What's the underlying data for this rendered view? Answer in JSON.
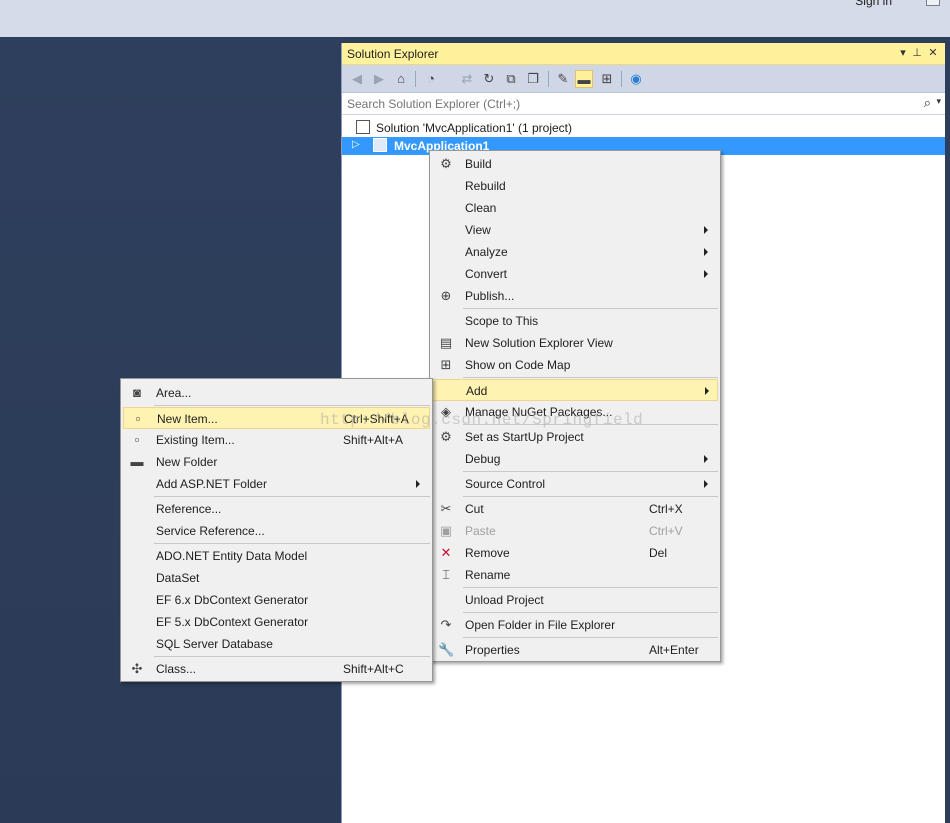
{
  "window": {
    "sign_in": "Sign in"
  },
  "solution_explorer": {
    "title": "Solution Explorer",
    "header_buttons": {
      "dropdown": "▾",
      "pin": "⊥",
      "close": "✕"
    },
    "search_placeholder": "Search Solution Explorer (Ctrl+;)",
    "tree": {
      "solution_label": "Solution 'MvcApplication1' (1 project)",
      "project_label": "MvcApplication1"
    },
    "toolbar_icons": [
      "back-icon",
      "forward-icon",
      "home-icon",
      "history-icon",
      "sync-icon",
      "refresh-icon",
      "collapse-all-icon",
      "copy-icon",
      "properties-icon",
      "preview-icon",
      "code-map-icon",
      "globe-icon"
    ]
  },
  "project_menu": {
    "items": [
      {
        "label": "Build",
        "icon": "build-icon",
        "glyph": "⚙"
      },
      {
        "label": "Rebuild"
      },
      {
        "label": "Clean"
      },
      {
        "label": "View",
        "submenu": true
      },
      {
        "label": "Analyze",
        "submenu": true
      },
      {
        "label": "Convert",
        "submenu": true
      },
      {
        "label": "Publish...",
        "icon": "publish-icon",
        "glyph": "⊕"
      },
      {
        "label": "Scope to This"
      },
      {
        "label": "New Solution Explorer View",
        "icon": "new-view-icon",
        "glyph": "▤"
      },
      {
        "label": "Show on Code Map",
        "icon": "code-map-icon",
        "glyph": "⊞"
      },
      {
        "label": "Add",
        "submenu": true,
        "highlighted": true
      },
      {
        "label": "Manage NuGet Packages...",
        "icon": "nuget-icon",
        "glyph": "◈"
      },
      {
        "label": "Set as StartUp Project",
        "icon": "gear-icon",
        "glyph": "⚙"
      },
      {
        "label": "Debug",
        "submenu": true
      },
      {
        "label": "Source Control",
        "submenu": true
      },
      {
        "label": "Cut",
        "shortcut": "Ctrl+X",
        "icon": "scissors-icon",
        "glyph": "✂"
      },
      {
        "label": "Paste",
        "shortcut": "Ctrl+V",
        "icon": "paste-icon",
        "glyph": "▣",
        "disabled": true
      },
      {
        "label": "Remove",
        "shortcut": "Del",
        "icon": "remove-icon",
        "glyph": "✕"
      },
      {
        "label": "Rename",
        "icon": "rename-icon",
        "glyph": "⌶"
      },
      {
        "label": "Unload Project"
      },
      {
        "label": "Open Folder in File Explorer",
        "icon": "open-folder-icon",
        "glyph": "↷"
      },
      {
        "label": "Properties",
        "shortcut": "Alt+Enter",
        "icon": "wrench-icon",
        "glyph": "🔧"
      }
    ]
  },
  "add_menu": {
    "items": [
      {
        "label": "Area...",
        "icon": "area-icon",
        "glyph": "◙"
      },
      {
        "label": "New Item...",
        "shortcut": "Ctrl+Shift+A",
        "icon": "new-item-icon",
        "glyph": "▫",
        "highlighted": true
      },
      {
        "label": "Existing Item...",
        "shortcut": "Shift+Alt+A",
        "icon": "existing-item-icon",
        "glyph": "▫"
      },
      {
        "label": "New Folder",
        "icon": "new-folder-icon",
        "glyph": "▬"
      },
      {
        "label": "Add ASP.NET Folder",
        "submenu": true
      },
      {
        "label": "Reference..."
      },
      {
        "label": "Service Reference..."
      },
      {
        "label": "ADO.NET Entity Data Model"
      },
      {
        "label": "DataSet"
      },
      {
        "label": "EF 6.x DbContext Generator"
      },
      {
        "label": "EF 5.x DbContext Generator"
      },
      {
        "label": "SQL Server Database"
      },
      {
        "label": "Class...",
        "shortcut": "Shift+Alt+C",
        "icon": "class-icon",
        "glyph": "✣"
      }
    ]
  },
  "watermark": "http://blog.csdn.net/Springfield"
}
